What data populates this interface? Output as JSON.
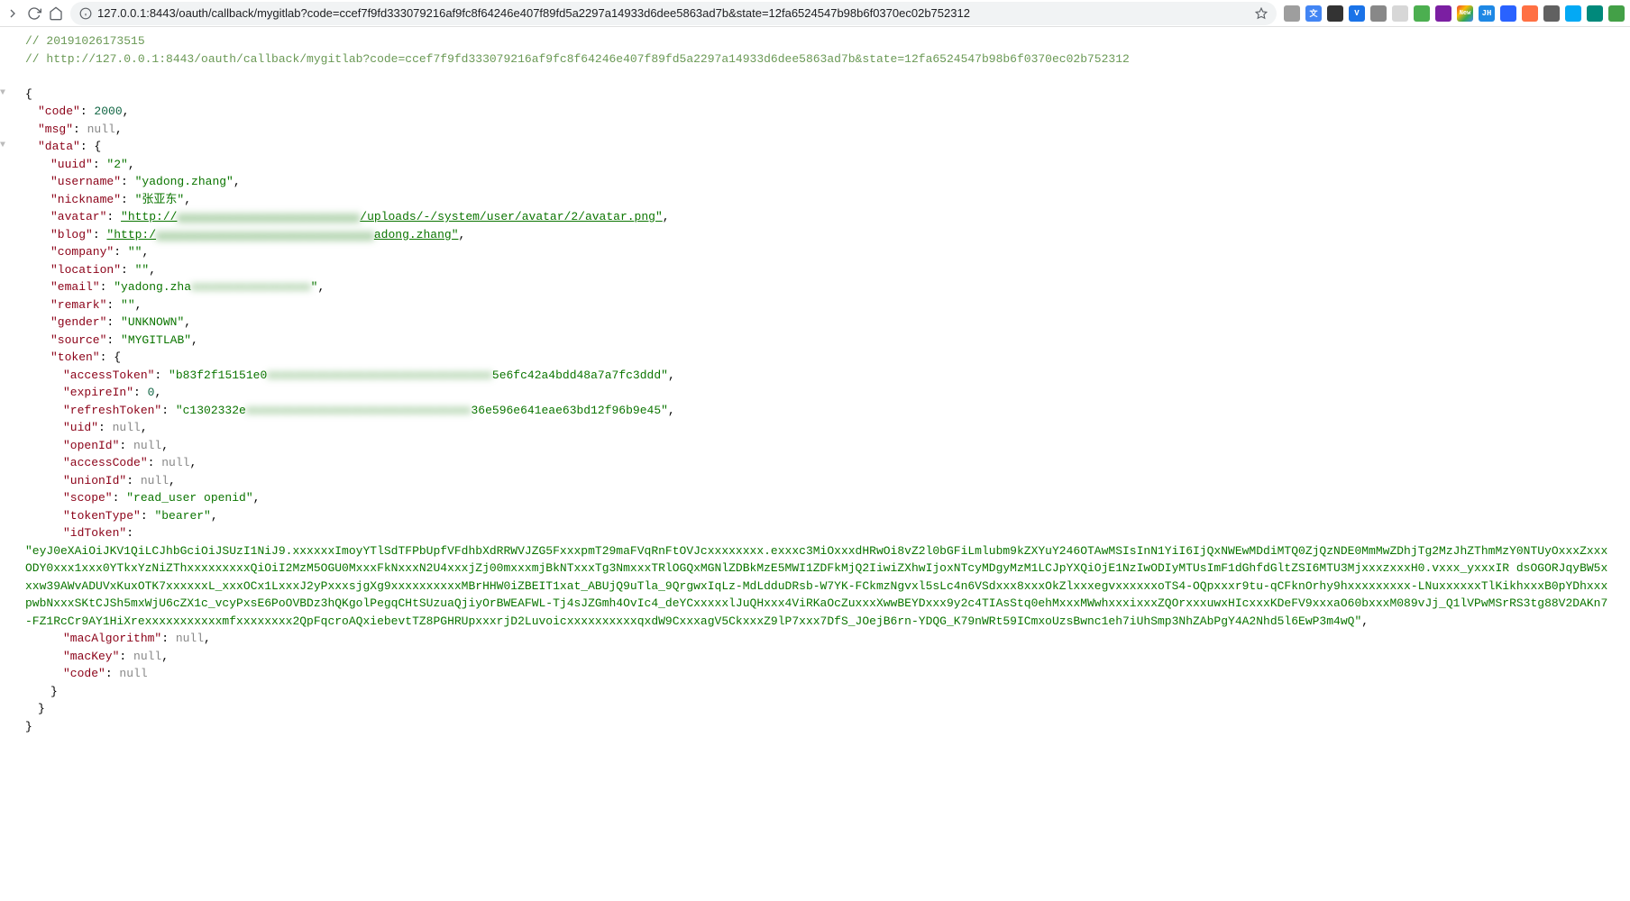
{
  "browser": {
    "url": "127.0.0.1:8443/oauth/callback/mygitlab?code=ccef7f9fd333079216af9fc8f64246e407f89fd5a2297a14933d6dee5863ad7b&state=12fa6524547b98b6f0370ec02b752312"
  },
  "json": {
    "comment_ts": "// 20191026173515",
    "comment_url": "// http://127.0.0.1:8443/oauth/callback/mygitlab?code=ccef7f9fd333079216af9fc8f64246e407f89fd5a2297a14933d6dee5863ad7b&state=12fa6524547b98b6f0370ec02b752312",
    "open_brace": "{",
    "close_brace": "}",
    "code_key": "\"code\"",
    "code_val": "2000",
    "msg_key": "\"msg\"",
    "null_val": "null",
    "data_key": "\"data\"",
    "uuid_key": "\"uuid\"",
    "uuid_val": "\"2\"",
    "username_key": "\"username\"",
    "username_val": "\"yadong.zhang\"",
    "nickname_key": "\"nickname\"",
    "nickname_val": "\"张亚东\"",
    "avatar_key": "\"avatar\"",
    "avatar_pre": "\"http://",
    "avatar_blur": "xxxxxxxxxxxxxxxxxxxxxxxxxx",
    "avatar_post": "/uploads/-/system/user/avatar/2/avatar.png\"",
    "blog_key": "\"blog\"",
    "blog_pre": "\"http:/",
    "blog_blur": "xxxxxxxxxxxxxxxxxxxxxxxxxxxxxxx",
    "blog_post": "adong.zhang\"",
    "company_key": "\"company\"",
    "empty_val": "\"\"",
    "location_key": "\"location\"",
    "email_key": "\"email\"",
    "email_pre": "\"yadong.zha",
    "email_blur": "xxxxxxxxxxxxxxxxx",
    "email_post": "\"",
    "remark_key": "\"remark\"",
    "gender_key": "\"gender\"",
    "gender_val": "\"UNKNOWN\"",
    "source_key": "\"source\"",
    "source_val": "\"MYGITLAB\"",
    "token_key": "\"token\"",
    "accessToken_key": "\"accessToken\"",
    "accessToken_pre": "\"b83f2f15151e0",
    "accessToken_blur": "xxxxxxxxxxxxxxxxxxxxxxxxxxxxxxxx",
    "accessToken_post": "5e6fc42a4bdd48a7a7fc3ddd\"",
    "expireIn_key": "\"expireIn\"",
    "expireIn_val": "0",
    "refreshToken_key": "\"refreshToken\"",
    "refreshToken_pre": "\"c1302332e",
    "refreshToken_blur": "xxxxxxxxxxxxxxxxxxxxxxxxxxxxxxxx",
    "refreshToken_post": "36e596e641eae63bd12f96b9e45\"",
    "uid_key": "\"uid\"",
    "openId_key": "\"openId\"",
    "accessCode_key": "\"accessCode\"",
    "unionId_key": "\"unionId\"",
    "scope_key": "\"scope\"",
    "scope_val": "\"read_user openid\"",
    "tokenType_key": "\"tokenType\"",
    "tokenType_val": "\"bearer\"",
    "idToken_key": "\"idToken\"",
    "idToken_val": "\"eyJ0eXAiOiJKV1QiLCJhbGciOiJSUzI1NiJ9.xxxxxxImoyYTlSdTFPbUpfVFdhbXdRRWVJZG5FxxxpmT29maFVqRnFtOVJcxxxxxxxx.exxxc3MiOxxxdHRwOi8vZ2l0bGFiLmlubm9kZXYuY246OTAwMSIsInN1YiI6IjQxNWEwMDdiMTQ0ZjQzNDE0MmMwZDhjTg2MzJhZThmMzY0NTUyOxxxZxxxODY0xxx1xxx0YTkxYzNiZThxxxxxxxxxQiOiI2MzM5OGU0MxxxFkNxxxN2U4xxxjZj00mxxxmjBkNTxxxTg3NmxxxTRlOGQxMGNlZDBkMzE5MWI1ZDFkMjQ2IiwiZXhwIjoxNTcyMDgyMzM1LCJpYXQiOjE1NzIwODIyMTUsImF1dGhfdGltZSI6MTU3MjxxxzxxxH0.vxxx_yxxxIR dsOGORJqyBW5xxxw39AWvADUVxKuxOTK7xxxxxxL_xxxOCx1LxxxJ2yPxxxsjgXg9xxxxxxxxxxMBrHHW0iZBEIT1xat_ABUjQ9uTla_9QrgwxIqLz-MdLdduDRsb-W7YK-FCkmzNgvxl5sLc4n6VSdxxx8xxxOkZlxxxegvxxxxxxoTS4-OQpxxxr9tu-qCFknOrhy9hxxxxxxxxx-LNuxxxxxxTlKikhxxxB0pYDhxxxpwbNxxxSKtCJSh5mxWjU6cZX1c_vcyPxsE6PoOVBDz3hQKgolPegqCHtSUzuaQjiyOrBWEAFWL-Tj4sJZGmh4OvIc4_deYCxxxxxlJuQHxxx4ViRKaOcZuxxxXwwBEYDxxx9y2c4TIAsStq0ehMxxxMWwhxxxixxxZQOrxxxuwxHIcxxxKDeFV9xxxaO60bxxxM089vJj_Q1lVPwMSrRS3tg88V2DAKn7-FZ1RcCr9AY1HiXrexxxxxxxxxxxmfxxxxxxxx2QpFqcroAQxiebevtTZ8PGHRUpxxxrjD2LuvoicxxxxxxxxxxqxdW9CxxxagV5CkxxxZ9lP7xxx7DfS_JOejB6rn-YDQG_K79nWRt59ICmxoUzsBwnc1eh7iUhSmp3NhZAbPgY4A2Nhd5l6EwP3m4wQ\"",
    "macAlgorithm_key": "\"macAlgorithm\"",
    "macKey_key": "\"macKey\"",
    "code2_key": "\"code\""
  }
}
